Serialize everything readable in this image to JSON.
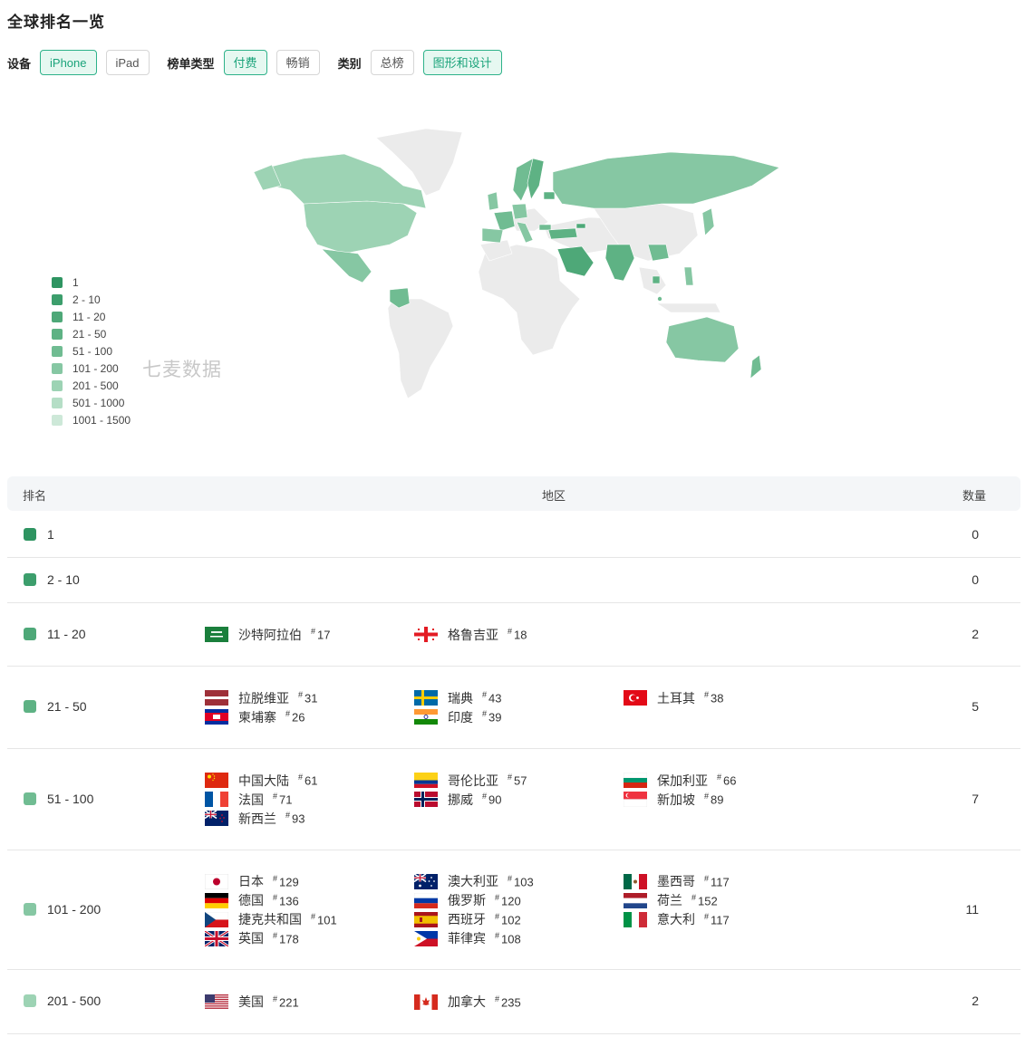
{
  "title": "全球排名一览",
  "filters": {
    "device_label": "设备",
    "device_options": [
      "iPhone",
      "iPad"
    ],
    "list_label": "榜单类型",
    "list_options": [
      "付费",
      "畅销"
    ],
    "category_label": "类别",
    "category_options": [
      "总榜",
      "图形和设计"
    ]
  },
  "legend": [
    {
      "label": "1",
      "color": "#2e9461"
    },
    {
      "label": "2 - 10",
      "color": "#3c9e6c"
    },
    {
      "label": "11 - 20",
      "color": "#4ea878"
    },
    {
      "label": "21 - 50",
      "color": "#5eb284"
    },
    {
      "label": "51 - 100",
      "color": "#70bc92"
    },
    {
      "label": "101 - 200",
      "color": "#86c7a3"
    },
    {
      "label": "201 - 500",
      "color": "#9dd3b4"
    },
    {
      "label": "501 - 1000",
      "color": "#b5dec6"
    },
    {
      "label": "1001 - 1500",
      "color": "#cde8d8"
    }
  ],
  "watermark": "七麦数据",
  "table": {
    "headers": {
      "rank": "排名",
      "region": "地区",
      "count": "数量"
    },
    "rows": [
      {
        "range": "1",
        "color": "#2e9461",
        "count": "0",
        "regions": []
      },
      {
        "range": "2 - 10",
        "color": "#3c9e6c",
        "count": "0",
        "regions": []
      },
      {
        "range": "11 - 20",
        "color": "#4ea878",
        "count": "2",
        "regions": [
          {
            "name": "沙特阿拉伯",
            "rank": "17",
            "flag": "saudi-arabia-flag-icon"
          },
          {
            "name": "格鲁吉亚",
            "rank": "18",
            "flag": "georgia-flag-icon"
          }
        ]
      },
      {
        "range": "21 - 50",
        "color": "#5eb284",
        "count": "5",
        "regions": [
          {
            "name": "拉脱维亚",
            "rank": "31",
            "flag": "latvia-flag-icon"
          },
          {
            "name": "柬埔寨",
            "rank": "26",
            "flag": "cambodia-flag-icon"
          },
          {
            "name": "瑞典",
            "rank": "43",
            "flag": "sweden-flag-icon"
          },
          {
            "name": "印度",
            "rank": "39",
            "flag": "india-flag-icon"
          },
          {
            "name": "土耳其",
            "rank": "38",
            "flag": "turkey-flag-icon"
          }
        ]
      },
      {
        "range": "51 - 100",
        "color": "#70bc92",
        "count": "7",
        "regions": [
          {
            "name": "中国大陆",
            "rank": "61",
            "flag": "china-flag-icon"
          },
          {
            "name": "法国",
            "rank": "71",
            "flag": "france-flag-icon"
          },
          {
            "name": "新西兰",
            "rank": "93",
            "flag": "new-zealand-flag-icon"
          },
          {
            "name": "哥伦比亚",
            "rank": "57",
            "flag": "colombia-flag-icon"
          },
          {
            "name": "挪威",
            "rank": "90",
            "flag": "norway-flag-icon"
          },
          {
            "name": "保加利亚",
            "rank": "66",
            "flag": "bulgaria-flag-icon"
          },
          {
            "name": "新加坡",
            "rank": "89",
            "flag": "singapore-flag-icon"
          }
        ]
      },
      {
        "range": "101 - 200",
        "color": "#86c7a3",
        "count": "11",
        "regions": [
          {
            "name": "日本",
            "rank": "129",
            "flag": "japan-flag-icon"
          },
          {
            "name": "德国",
            "rank": "136",
            "flag": "germany-flag-icon"
          },
          {
            "name": "捷克共和国",
            "rank": "101",
            "flag": "czech-flag-icon"
          },
          {
            "name": "英国",
            "rank": "178",
            "flag": "uk-flag-icon"
          },
          {
            "name": "澳大利亚",
            "rank": "103",
            "flag": "australia-flag-icon"
          },
          {
            "name": "俄罗斯",
            "rank": "120",
            "flag": "russia-flag-icon"
          },
          {
            "name": "西班牙",
            "rank": "102",
            "flag": "spain-flag-icon"
          },
          {
            "name": "菲律宾",
            "rank": "108",
            "flag": "philippines-flag-icon"
          },
          {
            "name": "墨西哥",
            "rank": "117",
            "flag": "mexico-flag-icon"
          },
          {
            "name": "荷兰",
            "rank": "152",
            "flag": "netherlands-flag-icon"
          },
          {
            "name": "意大利",
            "rank": "117",
            "flag": "italy-flag-icon"
          }
        ]
      },
      {
        "range": "201 - 500",
        "color": "#9dd3b4",
        "count": "2",
        "regions": [
          {
            "name": "美国",
            "rank": "221",
            "flag": "usa-flag-icon"
          },
          {
            "name": "加拿大",
            "rank": "235",
            "flag": "canada-flag-icon"
          }
        ]
      }
    ]
  }
}
